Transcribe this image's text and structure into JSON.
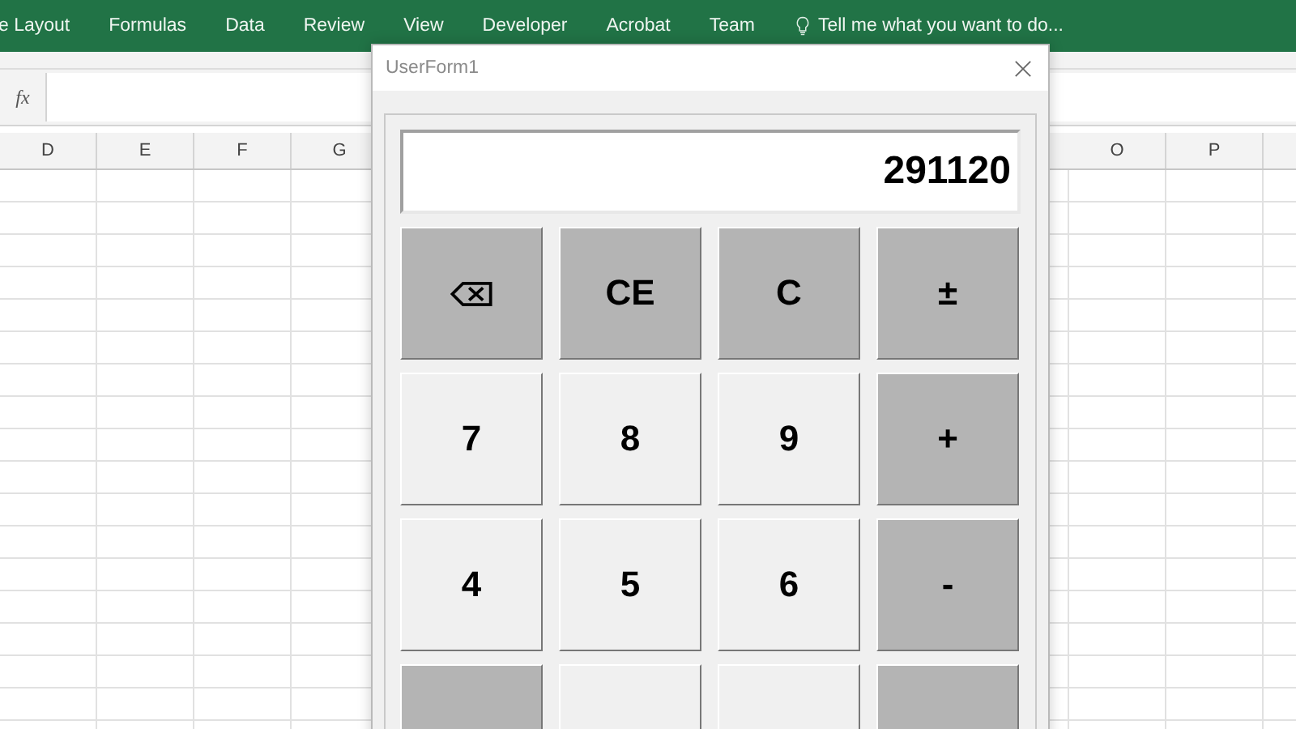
{
  "ribbon": {
    "tabs": [
      "e Layout",
      "Formulas",
      "Data",
      "Review",
      "View",
      "Developer",
      "Acrobat",
      "Team"
    ],
    "tell_me": "Tell me what you want to do..."
  },
  "formula_bar": {
    "fx": "fx"
  },
  "sheet": {
    "columns_left": [
      "D",
      "E",
      "F",
      "G"
    ],
    "columns_right": [
      "O",
      "P"
    ]
  },
  "userform": {
    "title": "UserForm1",
    "display": "291120",
    "buttons": [
      {
        "kind": "backspace"
      },
      {
        "kind": "op",
        "label": "CE"
      },
      {
        "kind": "op",
        "label": "C"
      },
      {
        "kind": "op",
        "label": "±"
      },
      {
        "kind": "digit",
        "label": "7"
      },
      {
        "kind": "digit",
        "label": "8"
      },
      {
        "kind": "digit",
        "label": "9"
      },
      {
        "kind": "op",
        "label": "+"
      },
      {
        "kind": "digit",
        "label": "4"
      },
      {
        "kind": "digit",
        "label": "5"
      },
      {
        "kind": "digit",
        "label": "6"
      },
      {
        "kind": "op",
        "label": "-"
      }
    ]
  }
}
